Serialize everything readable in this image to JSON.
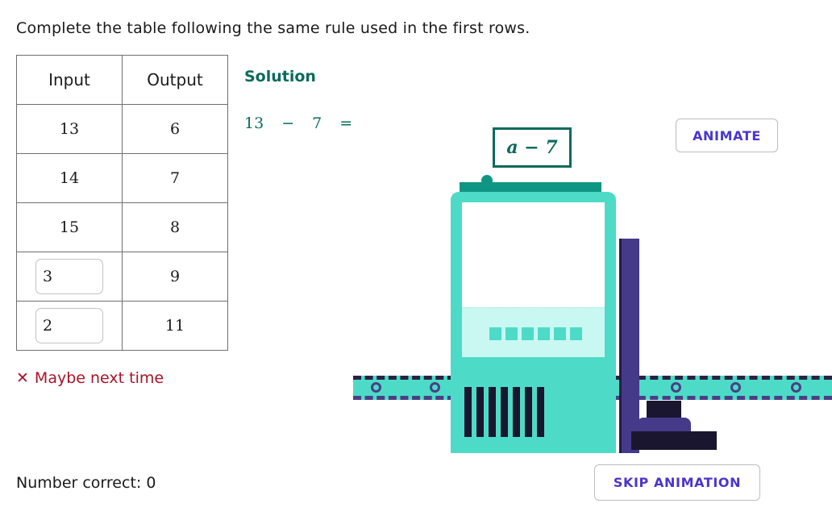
{
  "prompt": "Complete the table following the same rule used in the first rows.",
  "table": {
    "headers": [
      "Input",
      "Output"
    ],
    "rows": [
      {
        "input": "13",
        "output": "6",
        "editable": false
      },
      {
        "input": "14",
        "output": "7",
        "editable": false
      },
      {
        "input": "15",
        "output": "8",
        "editable": false
      },
      {
        "input": "3",
        "output": "9",
        "editable": true
      },
      {
        "input": "2",
        "output": "11",
        "editable": true
      }
    ]
  },
  "feedback": {
    "icon": "cross-icon",
    "glyph": "✕",
    "text": "Maybe next time",
    "color": "#a81428"
  },
  "score": {
    "text": "Number correct: 0",
    "label": "Number correct:",
    "value": "0"
  },
  "solution": {
    "title": "Solution",
    "color": "#0b6b5c",
    "equation": {
      "operand_left": "13",
      "operator": "−",
      "operand_right": "7",
      "equals": "="
    }
  },
  "formula_box": {
    "expression": "a − 7",
    "border_color": "#0b6b5c"
  },
  "buttons": {
    "animate": "ANIMATE",
    "skip": "SKIP ANIMATION",
    "text_color": "#4b35cc"
  },
  "machine": {
    "name": "function-machine",
    "body_color": "#4ddbc7",
    "accent_color": "#0e9683",
    "pillar_color": "#453a8a",
    "dark_color": "#1a1630",
    "tank_color": "#c9f8f2",
    "tank_block_count": 6,
    "grille_bar_count": 7,
    "belt_left_rollers": 2,
    "belt_right_rollers": 3
  }
}
